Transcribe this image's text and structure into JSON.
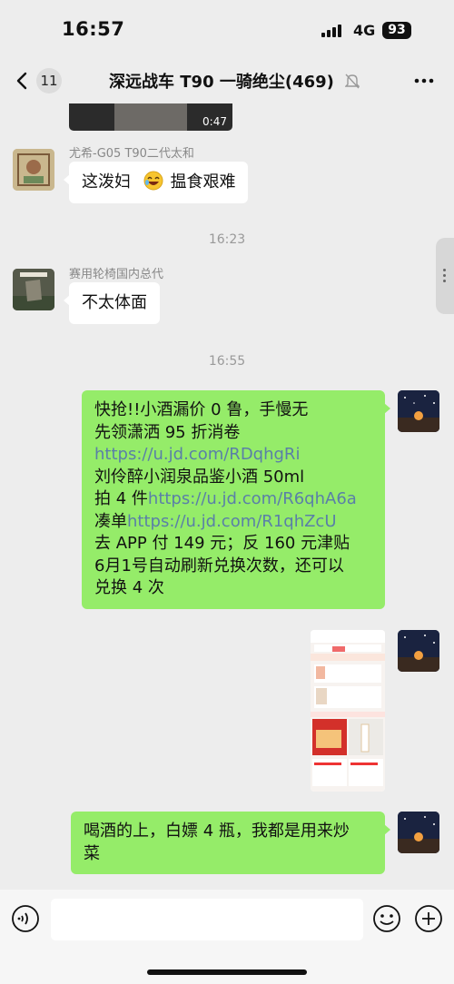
{
  "status": {
    "time": "16:57",
    "network": "4G",
    "battery": "93"
  },
  "nav": {
    "unread": "11",
    "title": "深远战车 T90 一骑绝尘(469)"
  },
  "messages": {
    "video_duration": "0:47",
    "m1": {
      "sender": "尤希-G05 T90二代太和",
      "text_a": "这泼妇",
      "text_b": "揾食艰难"
    },
    "ts1": "16:23",
    "m2": {
      "sender": "赛用轮椅国内总代",
      "text": "不太体面"
    },
    "ts2": "16:55",
    "m3": {
      "l1": "快抢!!小酒漏价 0 鲁，手慢无",
      "l2": "先领潇洒 95 折消卷",
      "l3_link": "https://u.jd.com/RDqhgRi",
      "l4": "刘伶醉小润泉品鉴小酒 50ml",
      "l5_prefix": "拍 4 件",
      "l5_link": "https://u.jd.com/R6qhA6a",
      "l6_prefix": "凑单",
      "l6_link": "https://u.jd.com/R1qhZcU",
      "l7": "去 APP 付 149 元；反 160 元津贴",
      "l8": "6月1号自动刷新兑换次数，还可以",
      "l9": "兑换 4 次"
    },
    "m5": {
      "l1": "喝酒的上，白嫖 4 瓶，我都是用来炒",
      "l2": "菜"
    }
  },
  "input": {
    "placeholder": ""
  },
  "colors": {
    "bubble_out": "#95ec69",
    "bubble_in": "#ffffff",
    "link": "#5a7fa8",
    "background": "#ededed"
  },
  "icons": [
    "chevron-left-icon",
    "mute-bell-icon",
    "more-icon",
    "voice-icon",
    "emoji-icon",
    "plus-icon",
    "laughing-emoji"
  ]
}
